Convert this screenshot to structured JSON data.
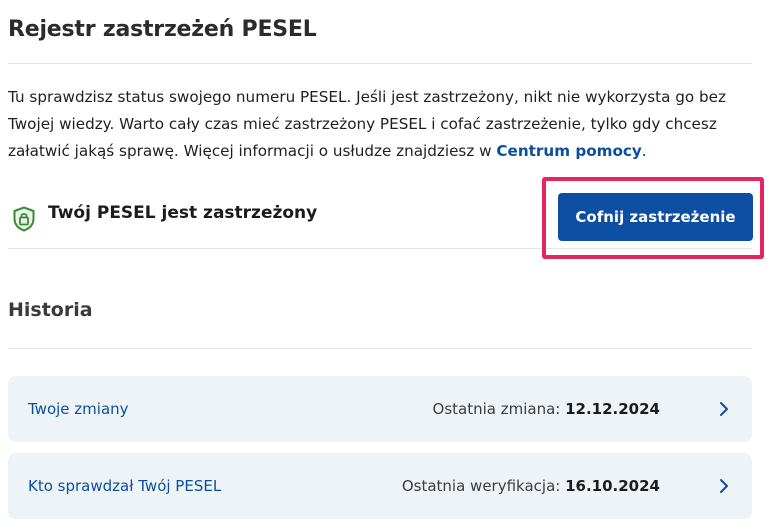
{
  "header": {
    "title": "Rejestr zastrzeżeń PESEL"
  },
  "intro": {
    "line1": "Tu sprawdzisz status swojego numeru PESEL. Jeśli jest zastrzeżony, nikt nie wykorzysta go bez",
    "line2": "Twojej wiedzy. Warto cały czas mieć zastrzeżony PESEL i cofać zastrzeżenie, tylko gdy chcesz",
    "line3_prefix": "załatwić jakąś sprawę. Więcej informacji o usłudze znajdziesz w ",
    "help_link": "Centrum pomocy",
    "line3_suffix": "."
  },
  "status": {
    "icon": "shield-check-icon",
    "text": "Twój PESEL jest zastrzeżony",
    "button_label": "Cofnij zastrzeżenie"
  },
  "history": {
    "title": "Historia",
    "items": [
      {
        "label": "Twoje zmiany",
        "meta_label": "Ostatnia zmiana: ",
        "meta_value": "12.12.2024"
      },
      {
        "label": "Kto sprawdzał Twój PESEL",
        "meta_label": "Ostatnia weryfikacja: ",
        "meta_value": "16.10.2024"
      }
    ]
  },
  "colors": {
    "primary": "#0c4ea2",
    "link": "#0b4f9c",
    "highlight": "#e8245f",
    "shield": "#3a8a3a",
    "row_background": "#eef3f8"
  }
}
